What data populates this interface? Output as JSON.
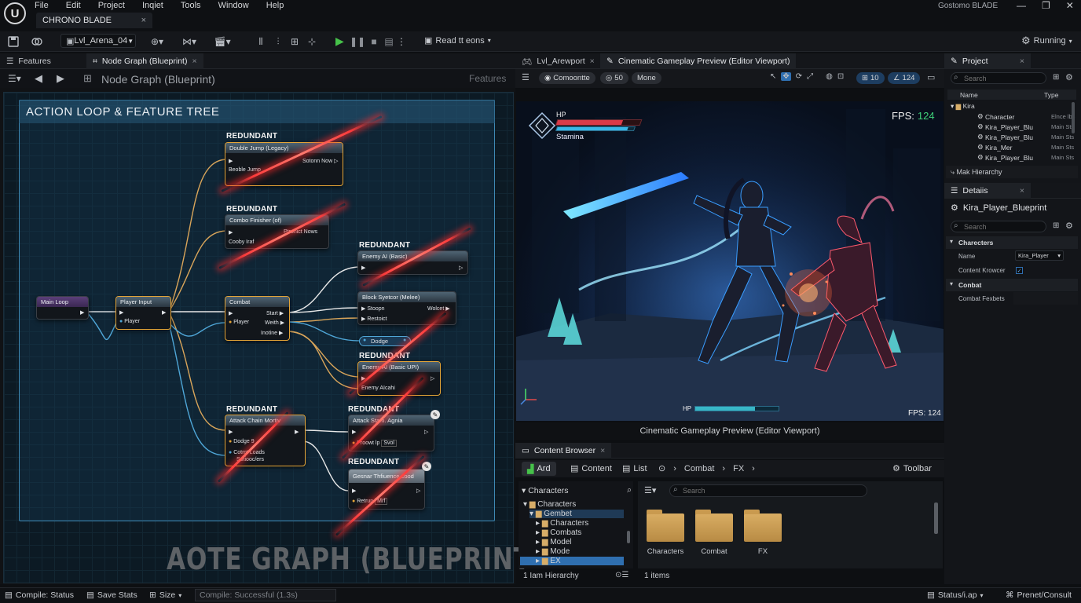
{
  "menubar": {
    "menus": [
      "File",
      "Edit",
      "Project",
      "Inqiet",
      "Tools",
      "Window",
      "Help"
    ],
    "doc_tab": "CHRONO BLADE",
    "doc_tab_close": "×",
    "project_name": "Gostomo BLADE",
    "window_controls": [
      "—",
      "❐",
      "✕"
    ]
  },
  "toolbar": {
    "level": "Lvl_Arena_04",
    "read_label": "Read tt eons",
    "settings_label": "Running"
  },
  "left_tabs": [
    {
      "label": "Features"
    },
    {
      "label": "Node Graph (Blueprint)"
    }
  ],
  "node_graph": {
    "header_title": "Node Graph (Blueprint)",
    "header_right": "Features",
    "comment_title": "ACTION LOOP & FEATURE TREE",
    "watermark": "AOTE GRAPH (BLUEPRINT",
    "redundant_label": "REDUNDANT",
    "nodes": {
      "main_loop": "Main Loop",
      "player_input": {
        "title": "Player Input",
        "pin": "Player"
      },
      "combat": {
        "title": "Combat",
        "pins": [
          "Player",
          "Start",
          "Weith",
          "Inotine"
        ]
      },
      "double_jump": {
        "title": "Double Jump (Legacy)",
        "pins": [
          "Beoble Jump",
          "Sotonn Now"
        ]
      },
      "combo_finisher": {
        "title": "Combo Finisher (of)",
        "pins": [
          "Cooby Iraf",
          "Ptronict Nows"
        ]
      },
      "enemy_ai_basic": {
        "title": "Enemy AI (Basic)"
      },
      "block_system": {
        "title": "Block Syetcor (Melee)",
        "pins": [
          "Stoopn",
          "Wolcet",
          "Restoict"
        ]
      },
      "dodge": {
        "title": "Dodge"
      },
      "enemy_ai_2": {
        "title": "Enemy AI (Basic UPI)",
        "pins": [
          "Enemy AIcahi"
        ]
      },
      "attack_chain": {
        "title": "Attack Chain Mortiv",
        "pins": [
          "Dodge 9",
          "Cotmt Loads",
          "Sotiooc/ers"
        ]
      },
      "attack_stam": {
        "title": "Attack Stam. Agnia",
        "pins": [
          "Proowt lp",
          "Svol"
        ]
      },
      "gesnar": {
        "title": "Gesnar Thfiuence cood",
        "pins": [
          "Retrun",
          "Mrf"
        ]
      }
    }
  },
  "viewport": {
    "tabs": [
      {
        "label": "Lvl_Arewport"
      },
      {
        "label": "Cinematic Gameplay Preview (Editor Viewport)"
      }
    ],
    "chips": [
      "Comoontte",
      "50",
      "Mone",
      "10",
      "124"
    ],
    "hp_label": "HP",
    "stamina_label": "Stamina",
    "fps_label": "FPS:",
    "fps_value": "124",
    "enemy_hp_label": "HP",
    "fps_bottom": "FPS: 124",
    "caption": "Cinematic Gameplay Preview (Editor Viewport)",
    "player_hp": 0.78,
    "player_stamina": 0.92,
    "enemy_hp": 0.72
  },
  "content_browser": {
    "tab": "Content Browser",
    "toolbar": {
      "add": "Ard",
      "content": "Content",
      "list": "List",
      "path": [
        "Combat",
        "FX"
      ],
      "toolbar_btn": "Toolbar"
    },
    "tree_header": "Characters",
    "tree": [
      {
        "label": "Characters",
        "depth": 0
      },
      {
        "label": "Gembet",
        "depth": 1
      },
      {
        "label": "Characters",
        "depth": 2
      },
      {
        "label": "Combats",
        "depth": 2
      },
      {
        "label": "Model",
        "depth": 2
      },
      {
        "label": "Mode",
        "depth": 2
      },
      {
        "label": "EX",
        "depth": 2
      }
    ],
    "search_placeholder": "Search",
    "folders": [
      "Characters",
      "Combat",
      "FX"
    ],
    "footer_left": "1 Iam Hierarchy",
    "footer_right": "1 items"
  },
  "project_panel": {
    "tab": "Project",
    "search_placeholder": "Search",
    "col_name": "Name",
    "col_type": "Type",
    "rows": [
      {
        "name": "Kira",
        "type": ""
      },
      {
        "name": "Character",
        "type": "Elnce lbs"
      },
      {
        "name": "Kira_Player_Blu",
        "type": "Main Sts"
      },
      {
        "name": "Kira_Player_Blu",
        "type": "Main Sts"
      },
      {
        "name": "Kira_Mer",
        "type": "Main Sts"
      },
      {
        "name": "Kira_Player_Blu",
        "type": "Main Sts"
      }
    ],
    "footer": "Mak Hierarchy"
  },
  "details_panel": {
    "tab": "Detaiis",
    "object_name": "Kira_Player_Blueprint",
    "search_placeholder": "Search",
    "section1": "Charecters",
    "name_label": "Name",
    "name_value": "Kira_Player",
    "content_label": "Content Krowcer",
    "section2": "Conbat",
    "combat_label": "Combat Fexbets"
  },
  "statusbar": {
    "compile": "Compile: Status",
    "save": "Save Stats",
    "size": "Size",
    "compile_result": "Compile: Successful (1.3s)",
    "status": "Status/i.ap",
    "consult": "Prenet/Consult"
  },
  "colors": {
    "accent": "#e4a436",
    "redundant": "#ff3b3b",
    "play": "#46c24a",
    "selection": "#2f6fb0"
  }
}
